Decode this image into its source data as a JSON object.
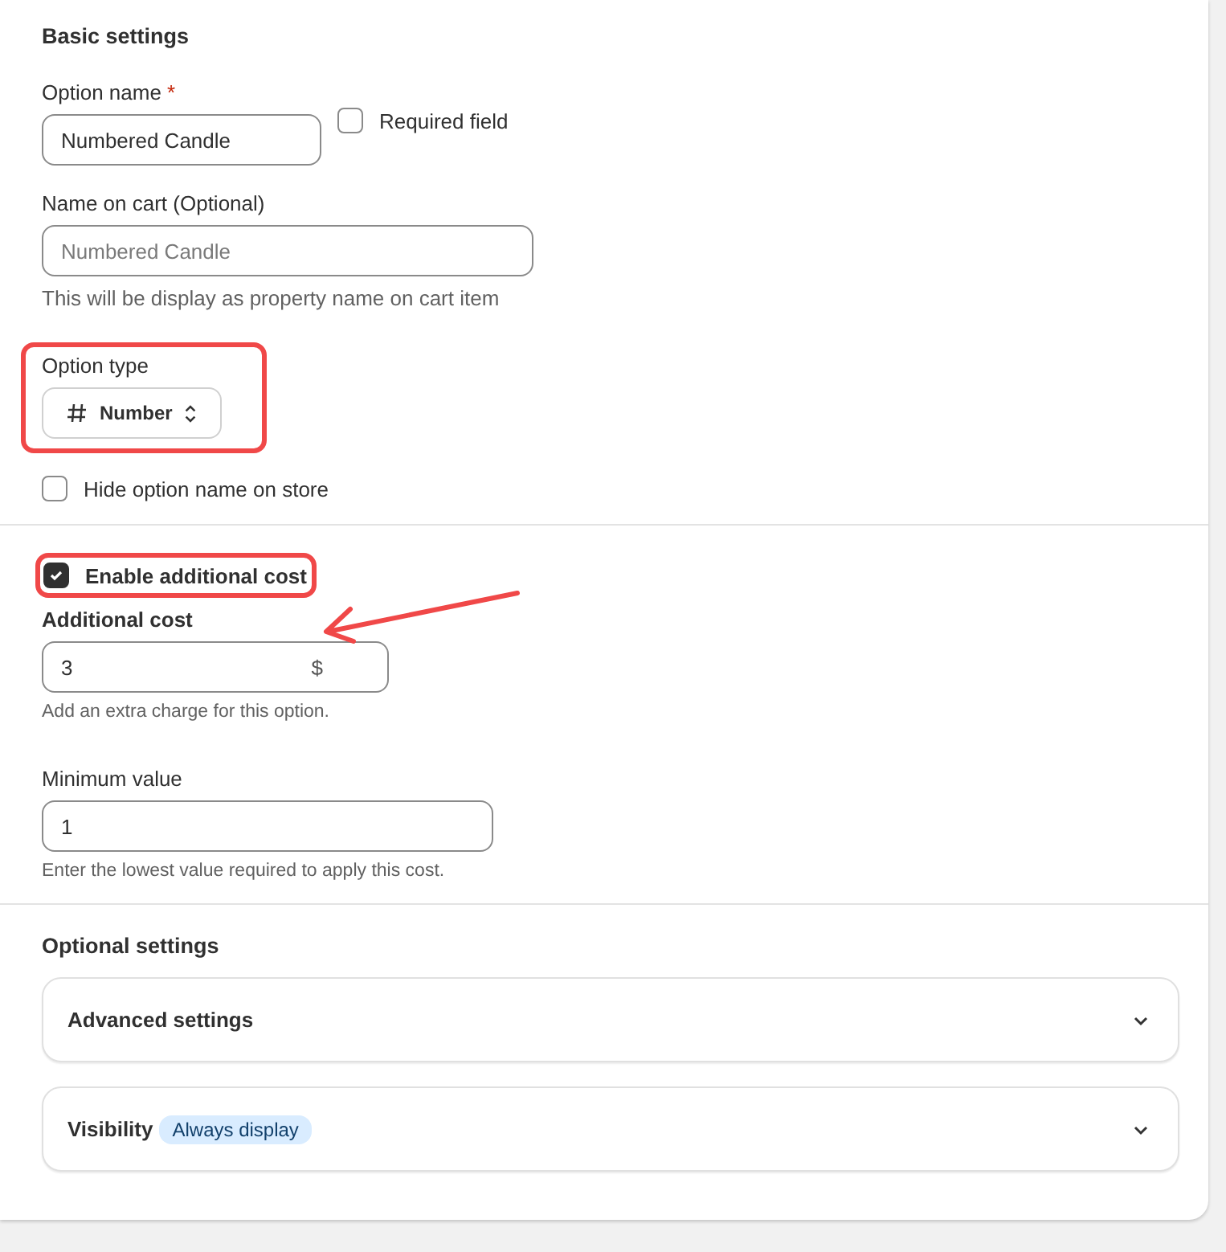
{
  "basic_settings": {
    "title": "Basic settings",
    "option_name": {
      "label": "Option name",
      "required_mark": "*",
      "value": "Numbered Candle"
    },
    "required_field": {
      "label": "Required field",
      "checked": false
    },
    "name_on_cart": {
      "label": "Name on cart (Optional)",
      "placeholder": "Numbered Candle",
      "help": "This will be display as property name on cart item"
    },
    "option_type": {
      "label": "Option type",
      "value": "Number"
    },
    "hide_option_name": {
      "label": "Hide option name on store",
      "checked": false
    }
  },
  "additional_cost": {
    "enable": {
      "label": "Enable additional cost",
      "checked": true
    },
    "cost": {
      "label": "Additional cost",
      "value": "3",
      "suffix": "$",
      "help": "Add an extra charge for this option."
    },
    "minimum": {
      "label": "Minimum value",
      "value": "1",
      "help": "Enter the lowest value required to apply this cost."
    }
  },
  "optional_settings": {
    "title": "Optional settings",
    "sections": [
      {
        "title": "Advanced settings",
        "expanded": false
      },
      {
        "title": "Visibility",
        "badge": "Always display",
        "expanded": false
      }
    ]
  }
}
